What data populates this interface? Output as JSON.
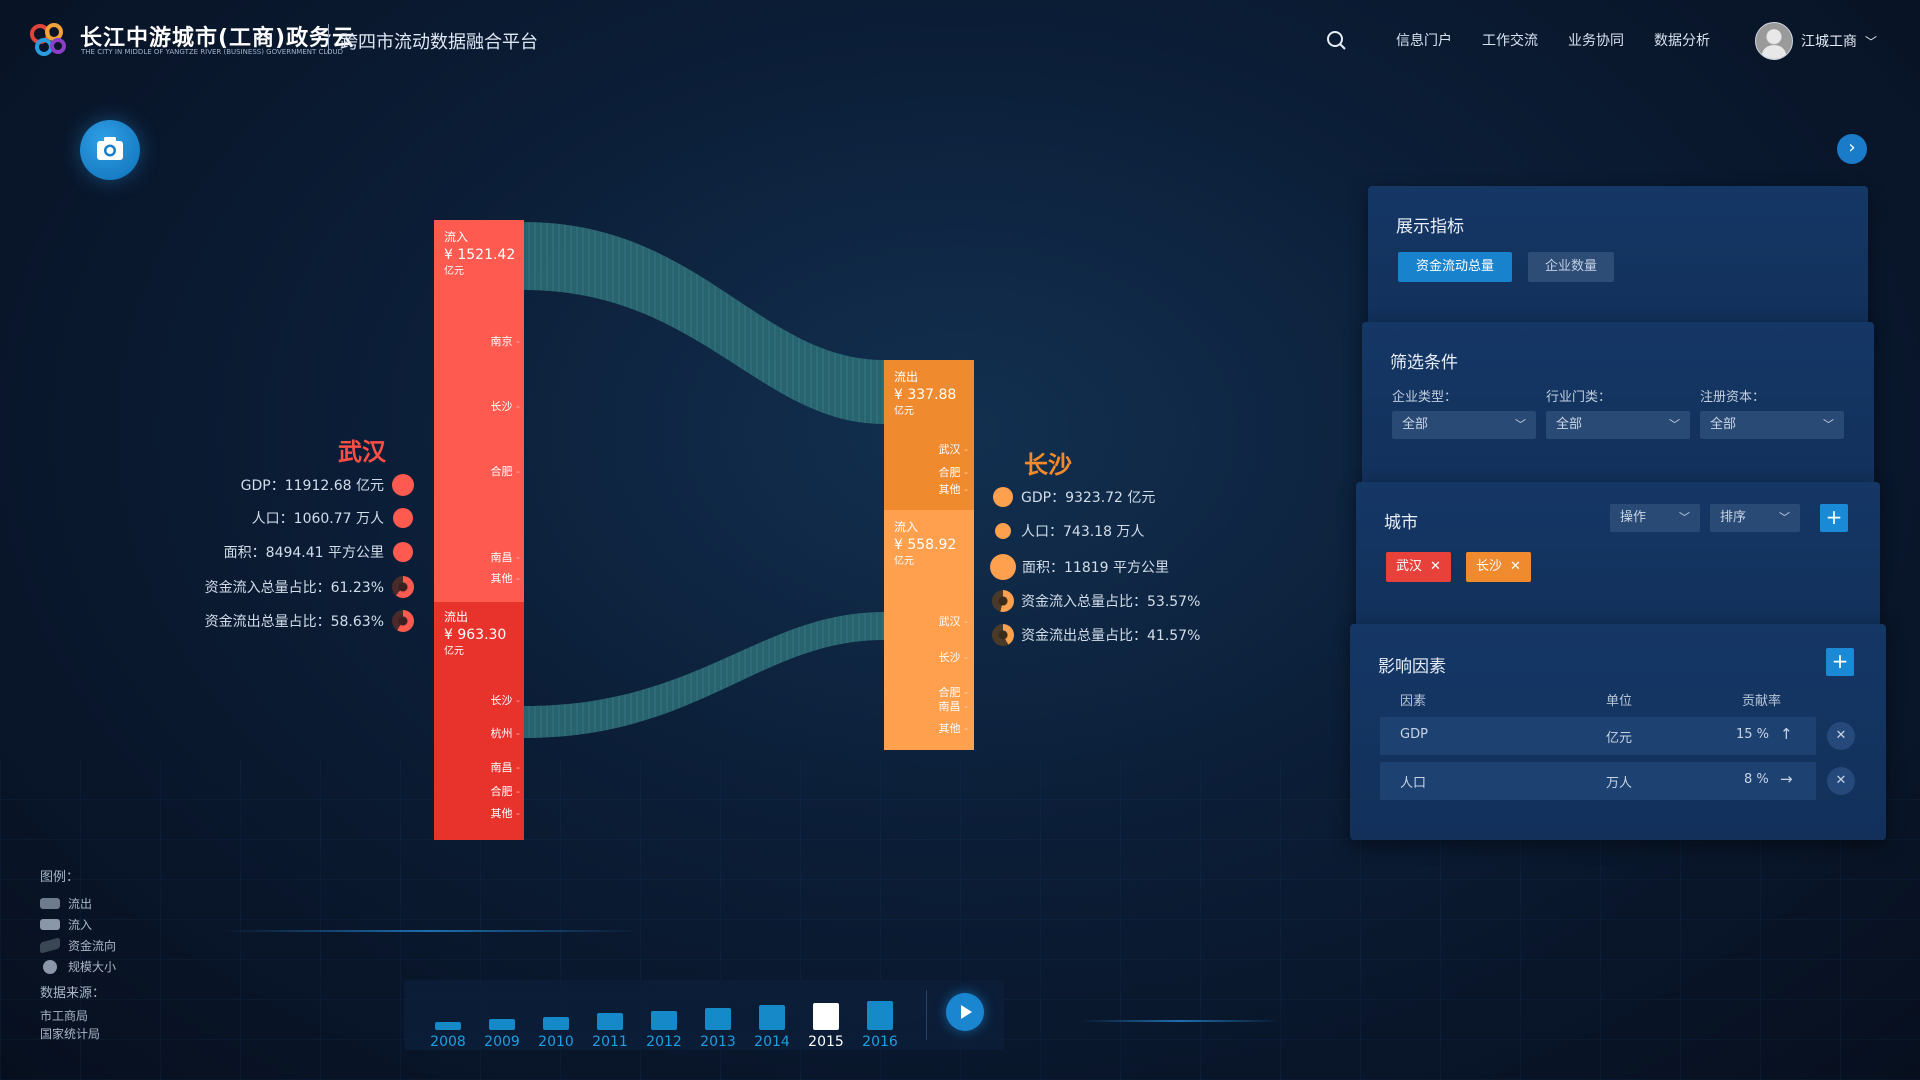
{
  "header": {
    "logo_title": "长江中游城市(工商)政务云",
    "logo_sub": "THE CITY IN MIDDLE OF YANGTZE RIVER (BUSINESS) GOVERNMENT CLOUD",
    "platform": "跨四市流动数据融合平台",
    "nav": [
      "信息门户",
      "工作交流",
      "业务协同",
      "数据分析"
    ],
    "user": "江城工商"
  },
  "wuhan": {
    "name": "武汉",
    "stats": [
      "GDP：11912.68 亿元",
      "人口：1060.77 万人",
      "面积：8494.41 平方公里",
      "资金流入总量占比：61.23%",
      "资金流出总量占比：58.63%"
    ],
    "inflow_label": "流入",
    "inflow_amount": "¥ 1521.42",
    "inflow_unit": "亿元",
    "inflow_ticks": [
      "南京",
      "长沙",
      "合肥",
      "南昌",
      "其他"
    ],
    "outflow_label": "流出",
    "outflow_amount": "¥ 963.30",
    "outflow_unit": "亿元",
    "outflow_ticks": [
      "长沙",
      "杭州",
      "南昌",
      "合肥",
      "其他"
    ],
    "inflow_color": "#ff5a4f",
    "outflow_color": "#e8332c"
  },
  "changsha": {
    "name": "长沙",
    "stats": [
      "GDP：9323.72 亿元",
      "人口：743.18 万人",
      "面积：11819 平方公里",
      "资金流入总量占比：53.57%",
      "资金流出总量占比：41.57%"
    ],
    "outflow_label": "流出",
    "outflow_amount": "¥ 337.88",
    "outflow_unit": "亿元",
    "outflow_ticks": [
      "武汉",
      "合肥",
      "其他"
    ],
    "inflow_label": "流入",
    "inflow_amount": "¥ 558.92",
    "inflow_unit": "亿元",
    "inflow_ticks": [
      "武汉",
      "长沙",
      "合肥",
      "南昌",
      "其他"
    ],
    "outflow_color": "#f08a2e",
    "inflow_color": "#ffa04f"
  },
  "flow_color": "#2b6a73",
  "legend": {
    "title": "图例：",
    "items": [
      "流出",
      "流入",
      "资金流向",
      "规模大小"
    ]
  },
  "source": {
    "title": "数据来源：",
    "items": [
      "市工商局",
      "国家统计局"
    ]
  },
  "timeline": {
    "years": [
      "2008",
      "2009",
      "2010",
      "2011",
      "2012",
      "2013",
      "2014",
      "2015",
      "2016"
    ],
    "active": "2015"
  },
  "display_panel": {
    "title": "展示指标",
    "primary": "资金流动总量",
    "secondary": "企业数量"
  },
  "filter_panel": {
    "title": "筛选条件",
    "fields": [
      {
        "label": "企业类型：",
        "value": "全部"
      },
      {
        "label": "行业门类：",
        "value": "全部"
      },
      {
        "label": "注册资本：",
        "value": "全部"
      }
    ]
  },
  "city_panel": {
    "title": "城市",
    "op": "操作",
    "sort": "排序",
    "tags": [
      "武汉",
      "长沙"
    ]
  },
  "factor_panel": {
    "title": "影响因素",
    "headers": [
      "因素",
      "单位",
      "贡献率"
    ],
    "rows": [
      {
        "factor": "GDP",
        "unit": "亿元",
        "rate": "15 %",
        "trend": "↑"
      },
      {
        "factor": "人口",
        "unit": "万人",
        "rate": "8 %",
        "trend": "→"
      }
    ]
  }
}
